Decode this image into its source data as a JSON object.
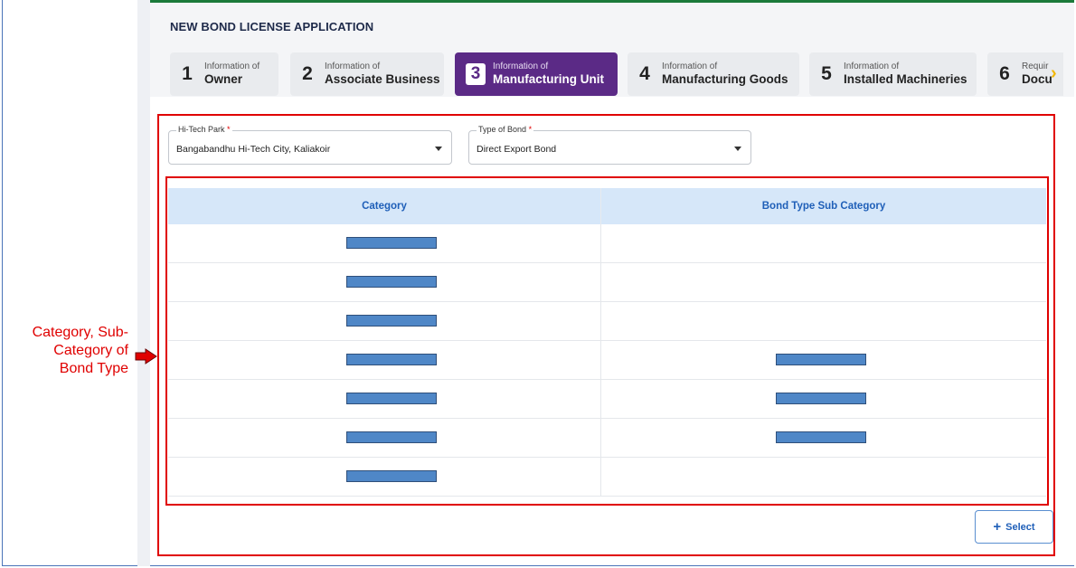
{
  "app": {
    "title": "NEW BOND LICENSE APPLICATION"
  },
  "steps": [
    {
      "number": "1",
      "small": "Information of",
      "big": "Owner",
      "active": false
    },
    {
      "number": "2",
      "small": "Information of",
      "big": "Associate Business",
      "active": false
    },
    {
      "number": "3",
      "small": "Information of",
      "big": "Manufacturing Unit",
      "active": true
    },
    {
      "number": "4",
      "small": "Information of",
      "big": "Manufacturing Goods",
      "active": false
    },
    {
      "number": "5",
      "small": "Information of",
      "big": "Installed Machineries",
      "active": false
    },
    {
      "number": "6",
      "small": "Requir",
      "big": "Docu",
      "active": false
    }
  ],
  "form": {
    "hitech_park": {
      "label": "Hi-Tech Park",
      "required_mark": "*",
      "value": "Bangabandhu Hi-Tech City, Kaliakoir"
    },
    "bond_type": {
      "label": "Type of Bond",
      "required_mark": "*",
      "value": "Direct Export Bond"
    }
  },
  "table": {
    "headers": [
      "Category",
      "Bond Type Sub Category"
    ],
    "rows": [
      {
        "category_redacted": true,
        "subcategory_redacted": false
      },
      {
        "category_redacted": true,
        "subcategory_redacted": false
      },
      {
        "category_redacted": true,
        "subcategory_redacted": false
      },
      {
        "category_redacted": true,
        "subcategory_redacted": true
      },
      {
        "category_redacted": true,
        "subcategory_redacted": true
      },
      {
        "category_redacted": true,
        "subcategory_redacted": true
      },
      {
        "category_redacted": true,
        "subcategory_redacted": false
      }
    ]
  },
  "select_button": {
    "icon": "plus-icon",
    "label": "Select"
  },
  "annotation": {
    "lines": [
      "Category, Sub-",
      "Category of",
      "Bond Type"
    ]
  },
  "colors": {
    "accent_purple": "#5b2a86",
    "header_blue": "#1f5fb8",
    "table_header_bg": "#d6e7f9",
    "annotation_red": "#e00000",
    "redaction_blue": "#4f87c7"
  }
}
